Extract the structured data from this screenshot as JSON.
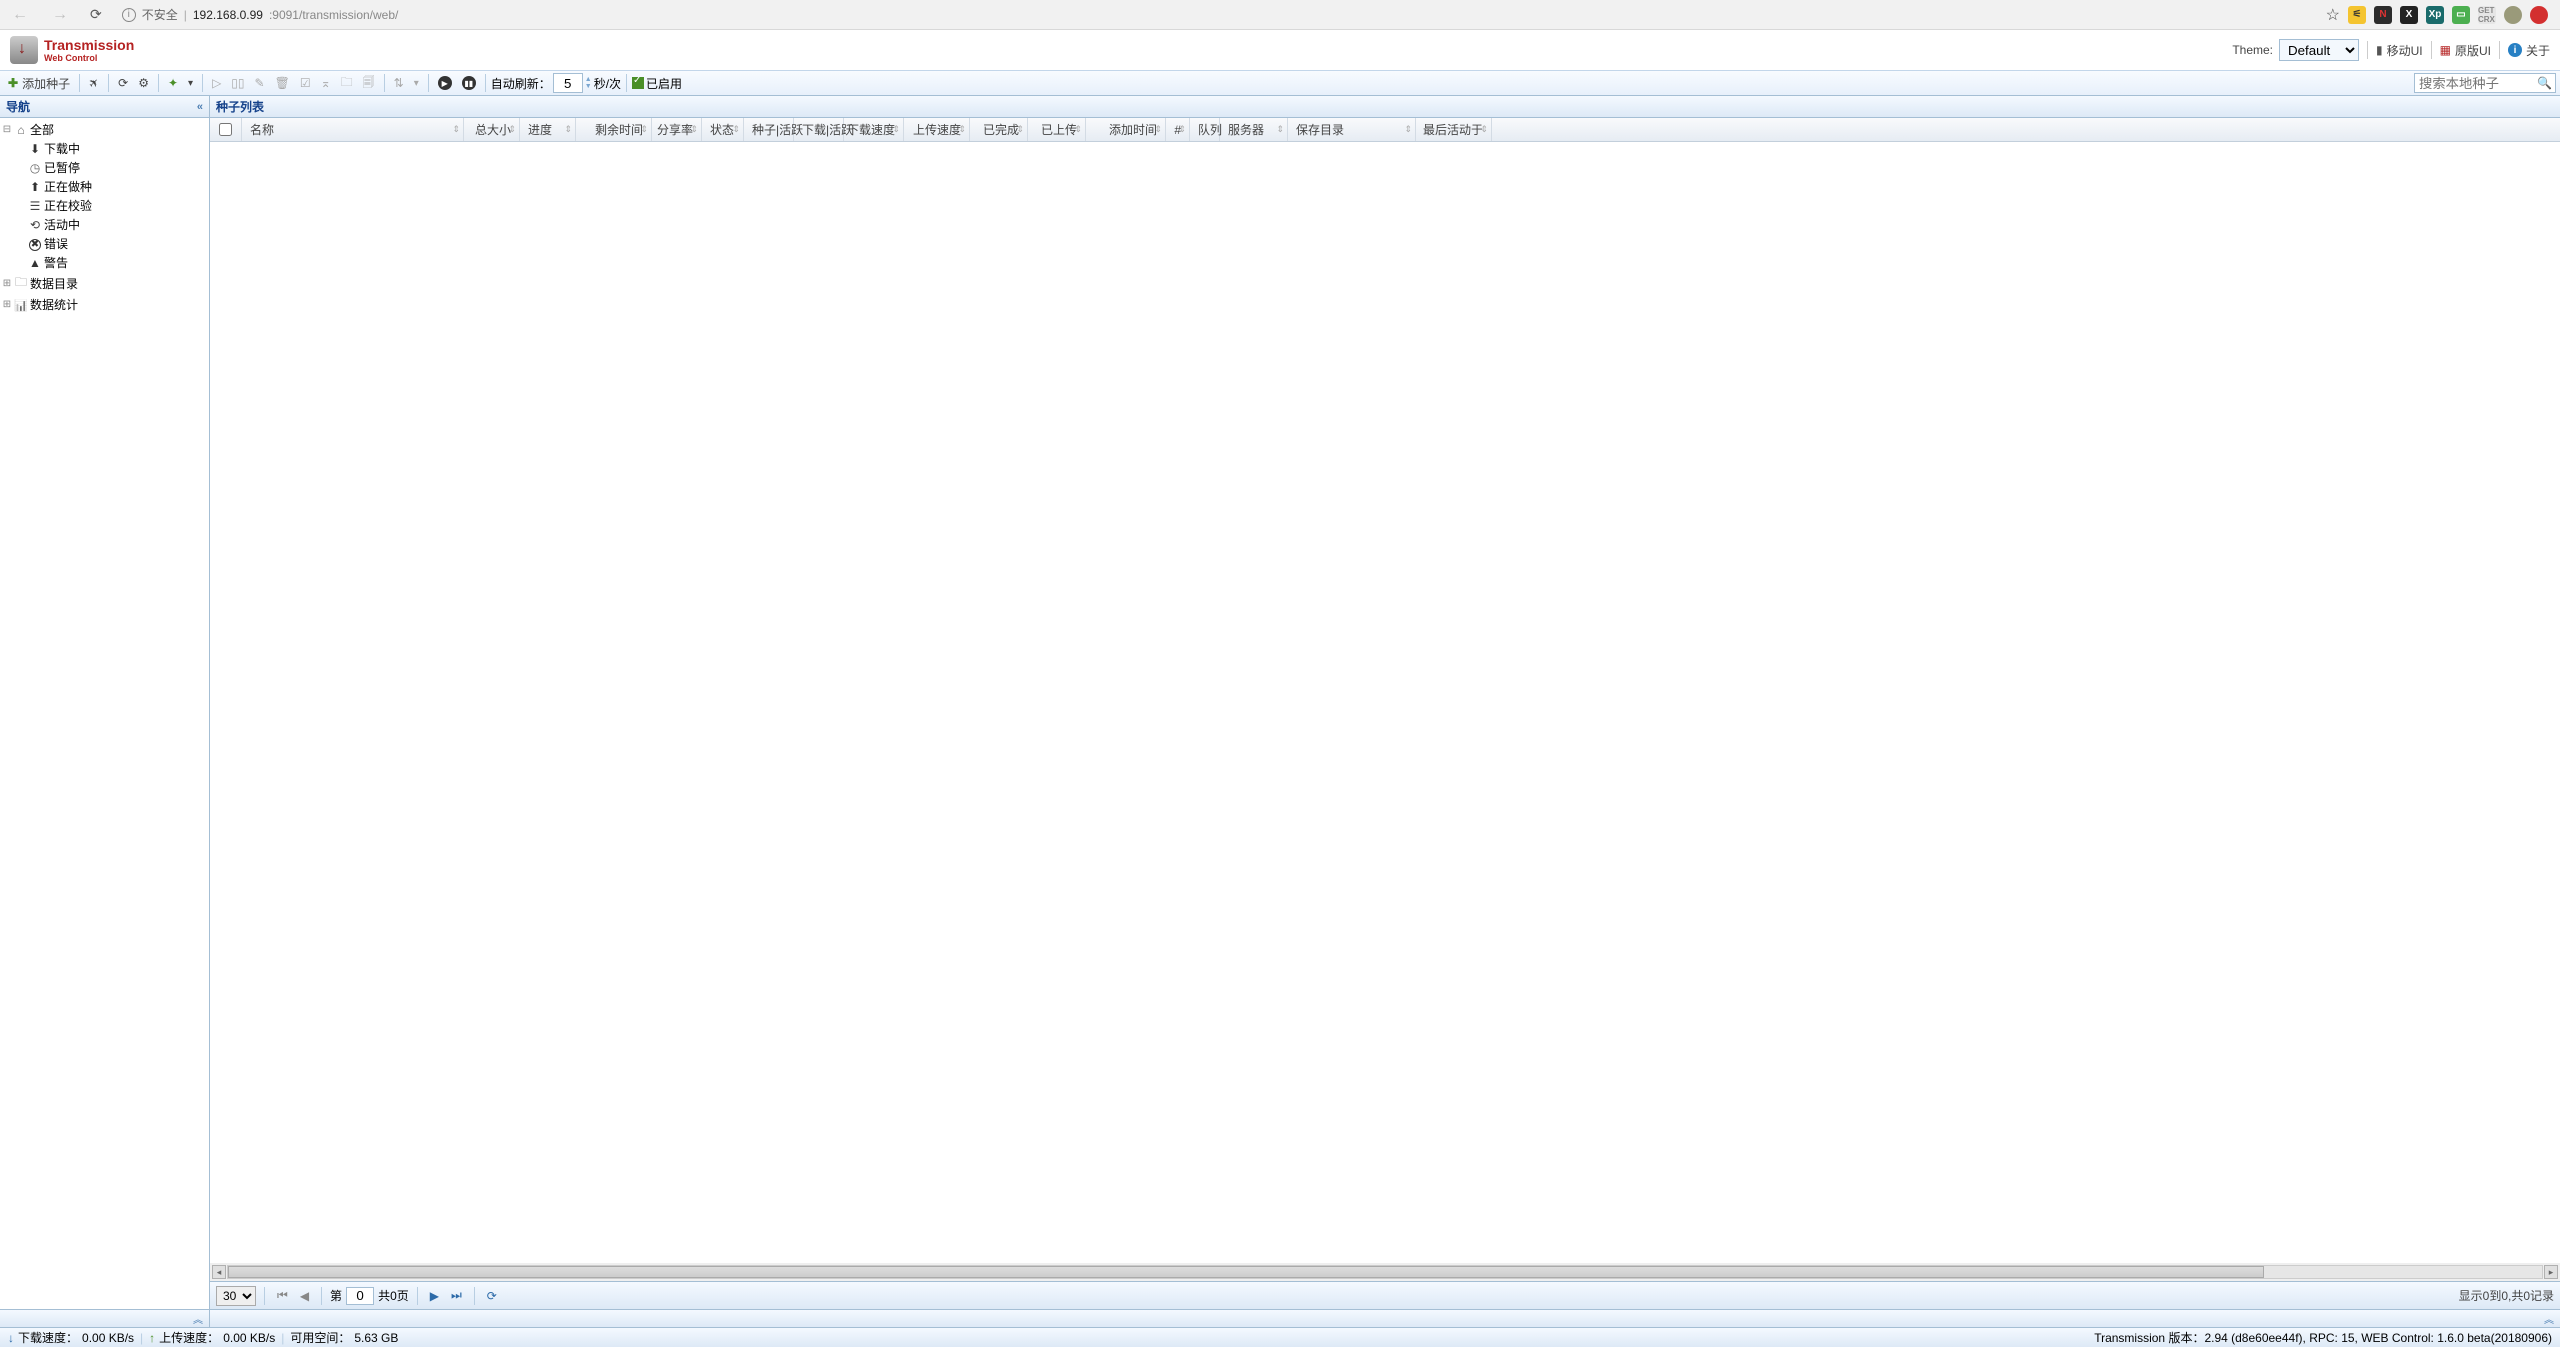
{
  "browser": {
    "unsafe_label": "不安全",
    "url_ip": "192.168.0.99",
    "url_port_path": ":9091/transmission/web/"
  },
  "header": {
    "title": "Transmission",
    "subtitle": "Web Control",
    "theme_label": "Theme:",
    "theme_value": "Default",
    "mobile_ui_label": "移动UI",
    "orig_ui_label": "原版UI",
    "about_label": "关于"
  },
  "toolbar": {
    "add_torrent": "添加种子",
    "auto_refresh_label": "自动刷新：",
    "auto_refresh_value": "5",
    "seconds_label": "秒/次",
    "enabled_label": "已启用",
    "search_placeholder": "搜索本地种子"
  },
  "sidebar": {
    "title": "导航",
    "nodes": {
      "all": "全部",
      "downloading": "下载中",
      "paused": "已暂停",
      "seeding": "正在做种",
      "checking": "正在校验",
      "active": "活动中",
      "error": "错误",
      "warning": "警告",
      "datadir": "数据目录",
      "stats": "数据统计"
    }
  },
  "content": {
    "title": "种子列表",
    "columns": {
      "name": "名称",
      "size": "总大小",
      "progress": "进度",
      "eta": "剩余时间",
      "ratio": "分享率",
      "status": "状态",
      "peers": "种子|活跃",
      "down_peers": "下载|活跃",
      "down_speed": "下载速度",
      "up_speed": "上传速度",
      "done": "已完成",
      "uploaded": "已上传",
      "added": "添加时间",
      "hash": "#",
      "queue": "队列",
      "server": "服务器",
      "save_dir": "保存目录",
      "last_active": "最后活动于"
    },
    "pager": {
      "page_size": "30",
      "page_label_prefix": "第",
      "page_value": "0",
      "page_total_label": "共0页",
      "display_text": "显示0到0,共0记录"
    }
  },
  "status": {
    "down_label": "下载速度：",
    "down_value": "0.00 KB/s",
    "up_label": "上传速度：",
    "up_value": "0.00 KB/s",
    "disk_label": "可用空间：",
    "disk_value": "5.63 GB",
    "version": "Transmission 版本：2.94 (d8e60ee44f), RPC: 15, WEB Control: 1.6.0 beta(20180906)"
  }
}
